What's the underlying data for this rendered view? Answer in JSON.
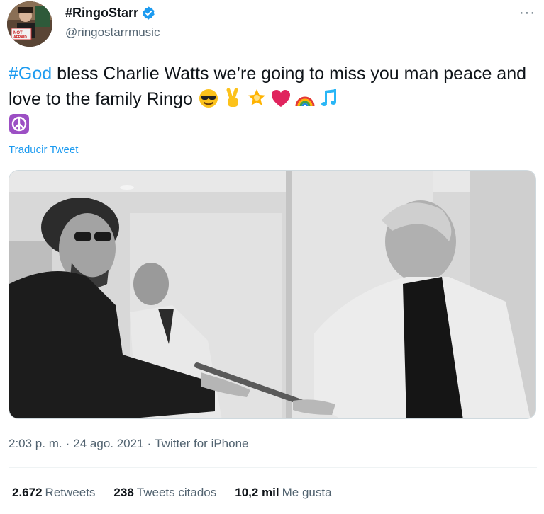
{
  "author": {
    "display_name": "#RingoStarr",
    "handle": "@ringostarrmusic",
    "verified": true,
    "avatar_sign_text": "NOT AFRAID"
  },
  "more_button": "···",
  "tweet": {
    "hashtag": "#God",
    "text": " bless Charlie Watts we’re going to miss you man peace and love to the family Ringo ",
    "emojis": [
      "sunglasses-face",
      "victory-hand",
      "glowing-star",
      "red-heart",
      "rainbow",
      "musical-notes",
      "peace-symbol"
    ]
  },
  "translate_label": "Traducir Tweet",
  "meta": {
    "time": "2:03 p. m.",
    "separator": "·",
    "date": "24 ago. 2021",
    "source": "Twitter for iPhone"
  },
  "stats": {
    "retweets_count": "2.672",
    "retweets_label": "Retweets",
    "quotes_count": "238",
    "quotes_label": "Tweets citados",
    "likes_count": "10,2 mil",
    "likes_label": "Me gusta"
  },
  "colors": {
    "link": "#1d9bf0",
    "secondary_text": "#536471",
    "primary_text": "#0f1419",
    "border": "#cfd9de"
  }
}
